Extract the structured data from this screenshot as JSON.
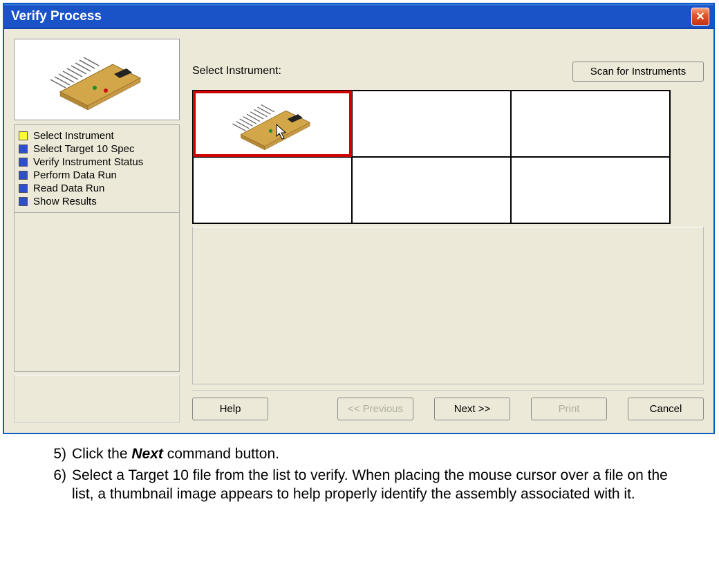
{
  "window": {
    "title": "Verify Process",
    "close_label": "X"
  },
  "sidebar": {
    "steps": [
      {
        "label": "Select Instrument",
        "bullet": "yellow"
      },
      {
        "label": "Select Target 10 Spec",
        "bullet": "blue"
      },
      {
        "label": "Verify Instrument Status",
        "bullet": "blue"
      },
      {
        "label": "Perform Data Run",
        "bullet": "blue"
      },
      {
        "label": "Read Data Run",
        "bullet": "blue"
      },
      {
        "label": "Show Results",
        "bullet": "blue"
      }
    ]
  },
  "main": {
    "select_instrument_label": "Select Instrument:",
    "scan_button": "Scan for Instruments"
  },
  "buttons": {
    "help": "Help",
    "prev": "<< Previous",
    "next": "Next >>",
    "print": "Print",
    "cancel": "Cancel"
  },
  "instructions": {
    "items": [
      {
        "num": "5)",
        "prefix": "Click the ",
        "bold": "Next",
        "suffix": " command button."
      },
      {
        "num": "6)",
        "prefix": "Select a Target 10 file from the list to verify. When placing the mouse cursor over a file on the list, a thumbnail image appears to help properly identify the assembly associated with it.",
        "bold": "",
        "suffix": ""
      }
    ]
  }
}
